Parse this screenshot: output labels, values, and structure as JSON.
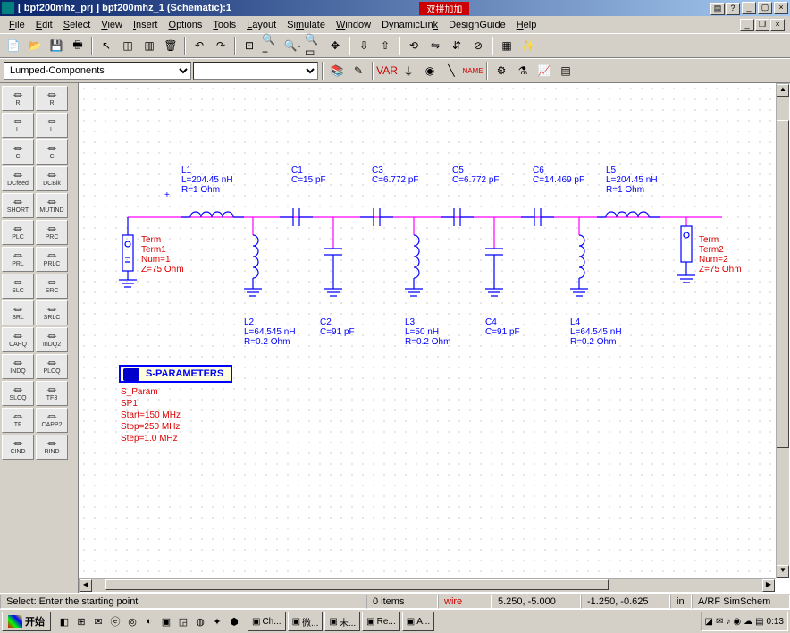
{
  "title": "[ bpf200mhz_prj ] bpf200mhz_1 (Schematic):1",
  "titleMid": "双拼加加",
  "menu": [
    "File",
    "Edit",
    "Select",
    "View",
    "Insert",
    "Options",
    "Tools",
    "Layout",
    "Simulate",
    "Window",
    "DynamicLink",
    "DesignGuide",
    "Help"
  ],
  "paletteCombo": "Lumped-Components",
  "secondCombo": "",
  "palette": [
    [
      "R",
      "R"
    ],
    [
      "L",
      "L"
    ],
    [
      "C",
      "C"
    ],
    [
      "DCfeed",
      "DCBlk"
    ],
    [
      "SHORT",
      "MUTIND"
    ],
    [
      "PLC",
      "PRC"
    ],
    [
      "PRL",
      "PRLC"
    ],
    [
      "SLC",
      "SRC"
    ],
    [
      "SRL",
      "SRLC"
    ],
    [
      "CAPQ",
      "InDQ2"
    ],
    [
      "INDQ",
      "PLCQ"
    ],
    [
      "SLCQ",
      "TF3"
    ],
    [
      "TF",
      "CAPP2"
    ],
    [
      "CIND",
      "RIND"
    ]
  ],
  "components": {
    "L1": {
      "name": "L1",
      "lines": [
        "L=204.45 nH",
        "R=1 Ohm"
      ]
    },
    "C1": {
      "name": "C1",
      "lines": [
        "C=15 pF"
      ]
    },
    "C3": {
      "name": "C3",
      "lines": [
        "C=6.772 pF"
      ]
    },
    "C5": {
      "name": "C5",
      "lines": [
        "C=6.772 pF"
      ]
    },
    "C6": {
      "name": "C6",
      "lines": [
        "C=14.469 pF"
      ]
    },
    "L5": {
      "name": "L5",
      "lines": [
        "L=204.45 nH",
        "R=1 Ohm"
      ]
    },
    "L2": {
      "name": "L2",
      "lines": [
        "L=64.545 nH",
        "R=0.2 Ohm"
      ]
    },
    "C2": {
      "name": "C2",
      "lines": [
        "C=91 pF"
      ]
    },
    "L3": {
      "name": "L3",
      "lines": [
        "L=50 nH",
        "R=0.2 Ohm"
      ]
    },
    "C4": {
      "name": "C4",
      "lines": [
        "C=91 pF"
      ]
    },
    "L4": {
      "name": "L4",
      "lines": [
        "L=64.545 nH",
        "R=0.2 Ohm"
      ]
    },
    "Term1": {
      "name": "Term",
      "lines": [
        "Term1",
        "Num=1",
        "Z=75 Ohm"
      ]
    },
    "Term2": {
      "name": "Term",
      "lines": [
        "Term2",
        "Num=2",
        "Z=75 Ohm"
      ]
    }
  },
  "simbox": {
    "title": "S-PARAMETERS",
    "body": [
      "S_Param",
      "SP1",
      "Start=150 MHz",
      "Stop=250 MHz",
      "Step=1.0 MHz"
    ]
  },
  "status": {
    "msg": "Select: Enter the starting point",
    "items": "0 items",
    "mode": "wire",
    "coord1": "5.250, -5.000",
    "coord2": "-1.250, -0.625",
    "unit": "in",
    "ctx": "A/RF SimSchem"
  },
  "taskbar": {
    "start": "开始",
    "tasks": [
      "Ch...",
      "微...",
      "未...",
      "Re...",
      "A..."
    ],
    "clock": "0:13"
  }
}
